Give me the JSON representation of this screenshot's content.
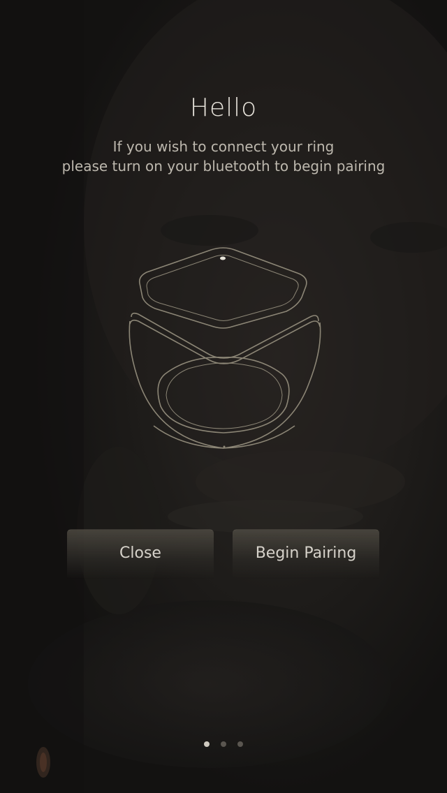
{
  "header": {
    "title": "Hello",
    "subtitle_line1": "If you wish to connect your ring",
    "subtitle_line2": "please turn on your bluetooth to begin pairing"
  },
  "illustration": {
    "icon": "ring-icon"
  },
  "actions": {
    "close_label": "Close",
    "pair_label": "Begin Pairing"
  },
  "pager": {
    "count": 3,
    "active_index": 0
  },
  "colors": {
    "background": "#141312",
    "ring_stroke": "#8c8676",
    "text": "#e6e2da"
  }
}
